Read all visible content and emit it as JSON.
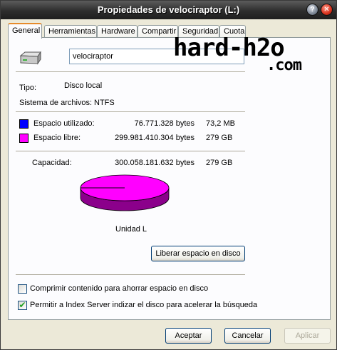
{
  "window": {
    "title": "Propiedades de velociraptor (L:)"
  },
  "icons": {
    "help": "help-icon",
    "close": "close-icon",
    "drive": "drive-icon",
    "check": "checkmark-icon"
  },
  "tabs": [
    {
      "label": "General",
      "active": true
    },
    {
      "label": "Herramientas",
      "active": false
    },
    {
      "label": "Hardware",
      "active": false
    },
    {
      "label": "Compartir",
      "active": false
    },
    {
      "label": "Seguridad",
      "active": false
    },
    {
      "label": "Cuota",
      "active": false
    }
  ],
  "general": {
    "volume_name": "velociraptor",
    "tipo_label": "Tipo:",
    "tipo_value": "Disco local",
    "fs_label": "Sistema de archivos:",
    "fs_value": "NTFS",
    "used_label": "Espacio utilizado:",
    "used_bytes": "76.771.328 bytes",
    "used_short": "73,2 MB",
    "free_label": "Espacio libre:",
    "free_bytes": "299.981.410.304 bytes",
    "free_short": "279 GB",
    "capacity_label": "Capacidad:",
    "capacity_bytes": "300.058.181.632 bytes",
    "capacity_short": "279 GB",
    "drive_label": "Unidad L",
    "cleanup_button": "Liberar espacio en disco",
    "compress_label": "Comprimir contenido para ahorrar espacio en disco",
    "compress_checked": false,
    "index_label": "Permitir a Index Server indizar el disco para acelerar la búsqueda",
    "index_checked": true
  },
  "colors": {
    "used": "#0000ff",
    "free": "#ff00ff",
    "free_side": "#8b008b"
  },
  "usage": {
    "used_fraction": 0.000256
  },
  "footer": {
    "ok": "Aceptar",
    "cancel": "Cancelar",
    "apply": "Aplicar"
  },
  "watermark": {
    "line1": "hard-h2o",
    "line2": ".com"
  }
}
